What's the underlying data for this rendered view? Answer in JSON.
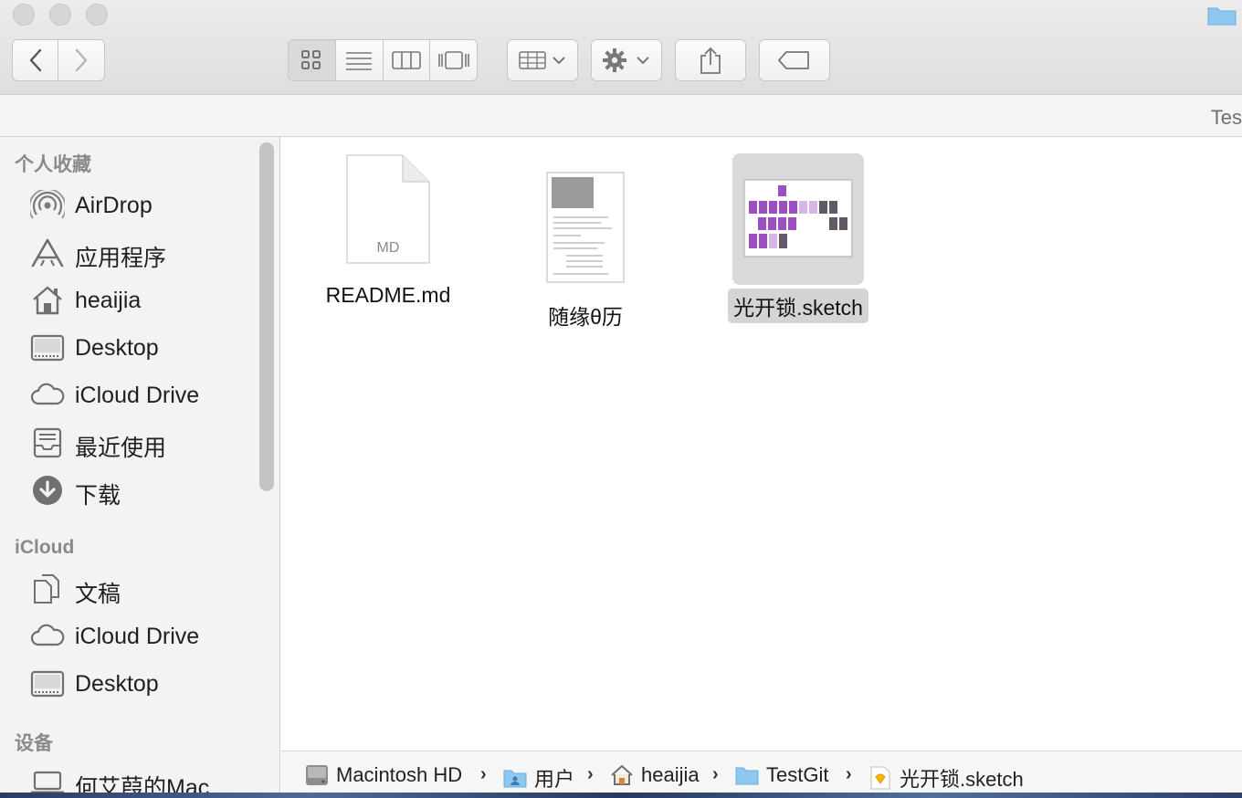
{
  "window": {
    "title_partial": "Tes"
  },
  "toolbar": {
    "back": "back",
    "forward": "forward",
    "view_modes": [
      "icon-view",
      "list-view",
      "column-view",
      "gallery-view"
    ],
    "active_view": "icon-view"
  },
  "sidebar": {
    "favorites_title": "个人收藏",
    "favorites": [
      {
        "label": "AirDrop",
        "icon": "airdrop-icon"
      },
      {
        "label": "应用程序",
        "icon": "applications-icon"
      },
      {
        "label": "heaijia",
        "icon": "home-icon"
      },
      {
        "label": "Desktop",
        "icon": "desktop-icon"
      },
      {
        "label": "iCloud Drive",
        "icon": "cloud-icon"
      },
      {
        "label": "最近使用",
        "icon": "recents-icon"
      },
      {
        "label": "下载",
        "icon": "downloads-icon"
      }
    ],
    "icloud_title": "iCloud",
    "icloud": [
      {
        "label": "文稿",
        "icon": "documents-icon"
      },
      {
        "label": "iCloud Drive",
        "icon": "cloud-icon"
      },
      {
        "label": "Desktop",
        "icon": "desktop-icon"
      }
    ],
    "devices_title": "设备",
    "devices": [
      {
        "label": "何艾葭的Mac...",
        "icon": "laptop-icon"
      }
    ]
  },
  "files": [
    {
      "name": "README.md",
      "badge": "MD",
      "selected": false
    },
    {
      "name": "随缘θ历",
      "selected": false
    },
    {
      "name": "光开锁.sketch",
      "selected": true
    }
  ],
  "pathbar": [
    {
      "label": "Macintosh HD",
      "icon": "harddisk-icon"
    },
    {
      "label": "用户",
      "icon": "users-folder-icon"
    },
    {
      "label": "heaijia",
      "icon": "home-icon"
    },
    {
      "label": "TestGit",
      "icon": "folder-icon"
    },
    {
      "label": "光开锁.sketch",
      "icon": "sketch-file-icon"
    }
  ],
  "separator": "›"
}
